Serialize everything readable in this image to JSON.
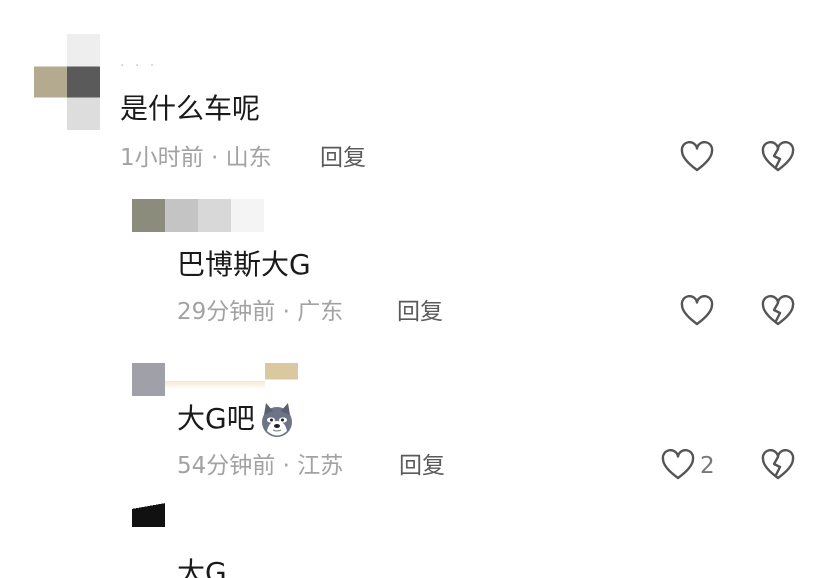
{
  "colors": {
    "text": "#1a1a1a",
    "meta": "#a2a2a2",
    "reply": "#5a5a5a",
    "icon": "#555555"
  },
  "comments": [
    {
      "text": "是什么车呢",
      "meta": "1小时前 · 山东",
      "reply_label": "回复",
      "like_icon": "heart-outline-icon",
      "dislike_icon": "broken-heart-icon"
    },
    {
      "text": "巴博斯大G",
      "meta": "29分钟前 · 广东",
      "reply_label": "回复",
      "like_icon": "heart-outline-icon",
      "dislike_icon": "broken-heart-icon"
    },
    {
      "text": "大G吧",
      "emoji": "husky-dog-emoji",
      "meta": "54分钟前 · 江苏",
      "reply_label": "回复",
      "like_count": "2",
      "like_icon": "heart-outline-icon",
      "dislike_icon": "broken-heart-icon"
    },
    {
      "text": "大G"
    }
  ]
}
